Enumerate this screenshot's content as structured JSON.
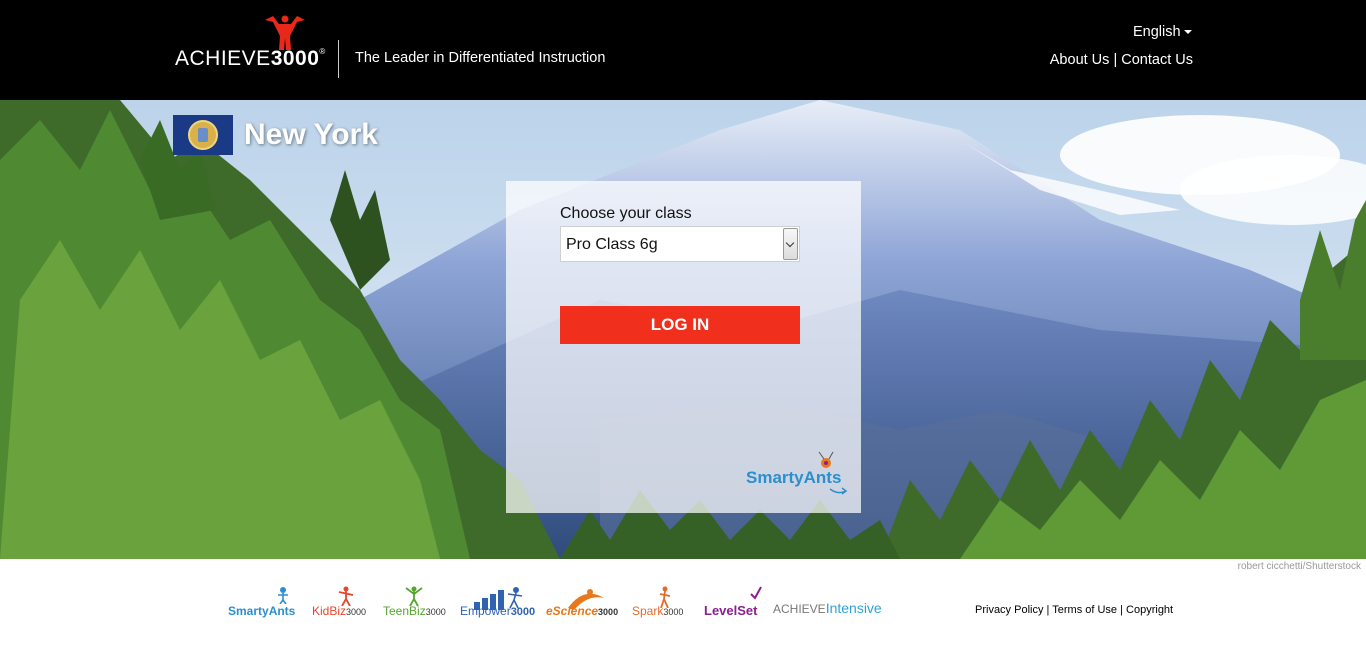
{
  "header": {
    "logo_text_regular": "ACHIEVE",
    "logo_text_bold": "3000",
    "logo_mark": "®",
    "tagline": "The Leader in Differentiated Instruction",
    "language": "English",
    "nav": [
      "About Us",
      "Contact Us"
    ],
    "nav_separator": "|",
    "icons": [
      "figure-logo-icon",
      "caret-down-icon"
    ],
    "colors": {
      "header_bg": "#000000",
      "logo_accent": "#e8281a"
    }
  },
  "hero": {
    "state_name": "New York",
    "flag_icon": "new-york-flag-icon"
  },
  "login": {
    "class_label": "Choose your class",
    "selected_class": "Pro Class 6g",
    "button_label": "LOG IN",
    "brand_logo": "SmartyAnts",
    "colors": {
      "button": "#f0301d"
    }
  },
  "footer": {
    "photo_credit": "robert cicchetti/Shutterstock",
    "brands": [
      {
        "name": "SmartyAnts",
        "color": "#2b8fce"
      },
      {
        "name": "KidBiz",
        "suffix": "3000",
        "color": "#e8452a"
      },
      {
        "name": "TeenBiz",
        "suffix": "3000",
        "color": "#55a630"
      },
      {
        "name": "Empower",
        "suffix": "3000",
        "color": "#2f62b0"
      },
      {
        "name": "eScience",
        "suffix": "3000",
        "color": "#e8781a"
      },
      {
        "name": "Spark",
        "suffix": "3000",
        "color": "#e26a2b"
      },
      {
        "name": "LevelSet",
        "color": "#8a1f8f"
      },
      {
        "name_regular": "ACHIEVE",
        "name_accent": "Intensive",
        "color": "#2fa3d8"
      }
    ],
    "links": [
      "Privacy Policy",
      "Terms of Use",
      "Copyright"
    ],
    "link_separator": "|"
  }
}
